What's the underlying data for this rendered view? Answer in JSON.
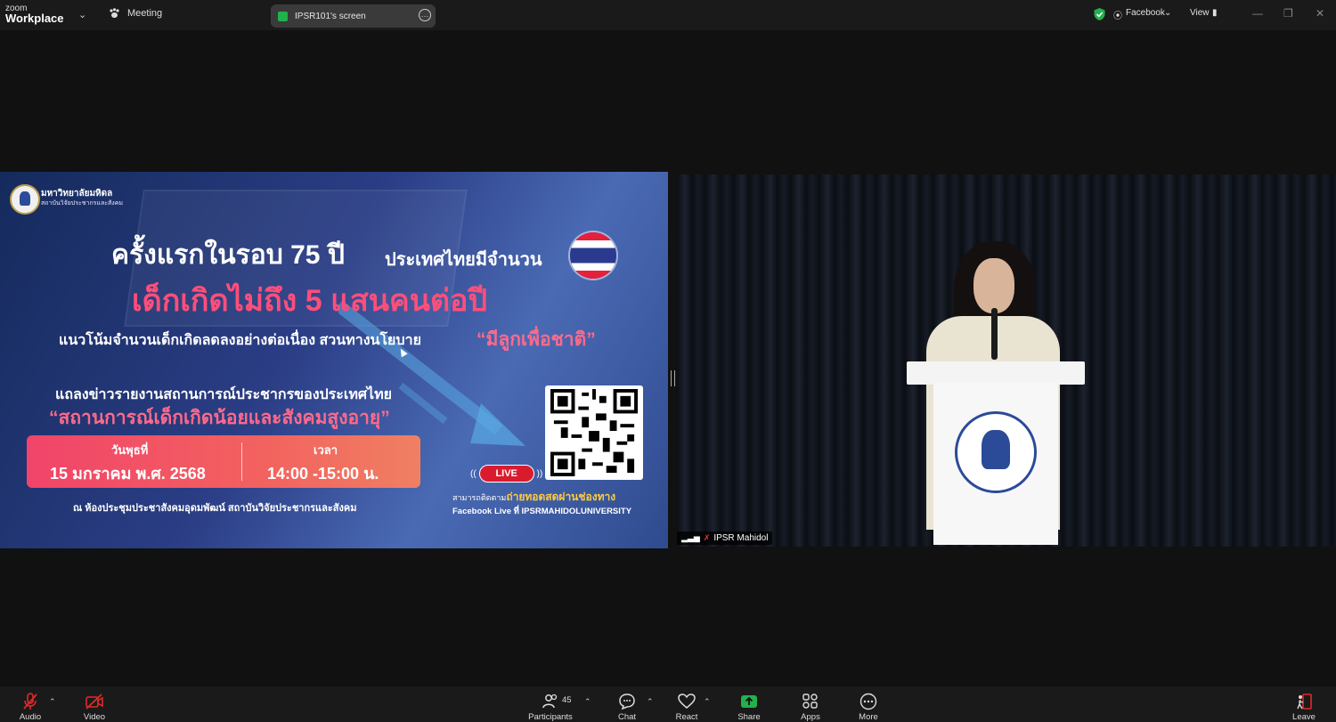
{
  "app": {
    "brand_top": "zoom",
    "brand_bottom": "Workplace",
    "meeting_label": "Meeting"
  },
  "share_pill": {
    "label": "IPSR101's screen"
  },
  "top_right": {
    "facebook_label": "Facebook",
    "view_label": "View"
  },
  "colors": {
    "accent_green": "#22b14c",
    "leave_red": "#e02a2a",
    "slide_pink": "#ff4e7a"
  },
  "slide": {
    "org_name": "มหาวิทยาลัยมหิดล",
    "org_sub": "สถาบันวิจัยประชากรและสังคม",
    "headline_part1": "ครั้งแรกในรอบ 75 ปี",
    "headline_part2": "ประเทศไทยมีจำนวน",
    "headline_main": "เด็กเกิดไม่ถึง 5 แสนคนต่อปี",
    "sub_part1": "แนวโน้มจำนวนเด็กเกิดลดลงอย่างต่อเนื่อง สวนทางนโยบาย",
    "sub_part2": "“มีลูกเพื่อชาติ”",
    "press_line": "แถลงข่าวรายงานสถานการณ์ประชากรของประเทศไทย",
    "press_title": "“สถานการณ์เด็กเกิดน้อยและสังคมสูงอายุ”",
    "date_label": "วันพุธที่",
    "date_value": "15 มกราคม พ.ศ. 2568",
    "time_label": "เวลา",
    "time_value": "14:00 -15:00 น.",
    "venue": "ณ ห้องประชุมประชาสังคมอุดมพัฒน์ สถาบันวิจัยประชากรและสังคม",
    "live_label": "LIVE",
    "follow_prefix": "สามารถติดตาม",
    "follow_highlight": "ถ่ายทอดสดผ่านช่องทาง",
    "facebook_line": "Facebook Live ที่ IPSRMAHIDOLUNIVERSITY"
  },
  "video_tile": {
    "participant_name": "IPSR Mahidol"
  },
  "toolbar": {
    "audio": "Audio",
    "video": "Video",
    "participants": "Participants",
    "participants_count": "45",
    "chat": "Chat",
    "react": "React",
    "share": "Share",
    "apps": "Apps",
    "more": "More",
    "leave": "Leave"
  }
}
